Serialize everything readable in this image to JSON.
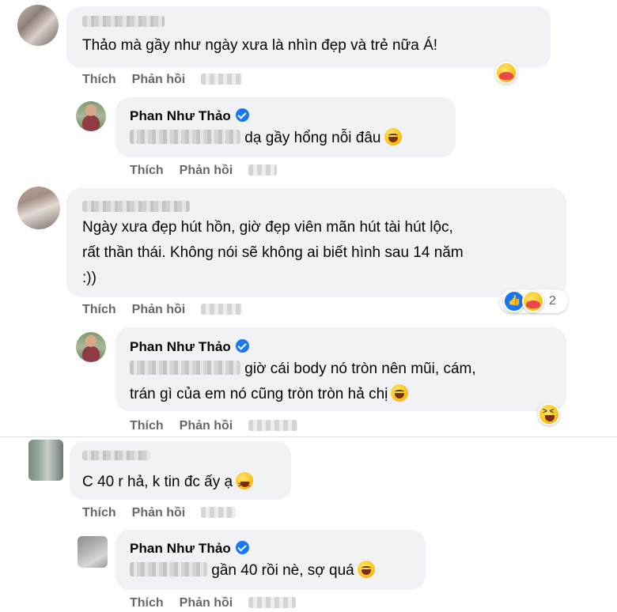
{
  "comments": [
    {
      "text": "Thảo mà gầy như ngày xưa là nhìn đẹp và trẻ nữa Á!",
      "actions": {
        "like": "Thích",
        "reply": "Phản hồi"
      },
      "reply": {
        "author": "Phan Như Thảo",
        "text": "dạ gầy hổng nỗi đâu",
        "actions": {
          "like": "Thích",
          "reply": "Phản hồi"
        }
      }
    },
    {
      "lines": [
        "Ngày xưa đẹp hút hồn, giờ đẹp viên mãn hút tài hút lộc,",
        "rất thần thái. Không nói sẽ không ai biết hình sau 14 năm",
        ":))"
      ],
      "reaction_count": "2",
      "actions": {
        "like": "Thích",
        "reply": "Phản hồi"
      },
      "reply": {
        "author": "Phan Như Thảo",
        "line1": "giờ cái body nó tròn nên mũi, cám,",
        "line2": "trán gì của em nó cũng tròn tròn hả chị",
        "actions": {
          "like": "Thích",
          "reply": "Phản hồi"
        }
      }
    },
    {
      "text": "C 40 r hả, k tin đc ấy ạ",
      "actions": {
        "like": "Thích",
        "reply": "Phản hồi"
      },
      "reply": {
        "author": "Phan Như Thảo",
        "text": "gần 40 rồi nè, sợ quá",
        "actions": {
          "like": "Thích",
          "reply": "Phản hồi"
        }
      }
    }
  ],
  "icons": [
    "laughing-emoji-icon",
    "squinting-laugh-emoji-icon",
    "care-reaction-icon",
    "like-reaction-icon",
    "haha-reaction-icon",
    "verified-badge-icon"
  ],
  "colors": {
    "bubble": "#f0f2f5",
    "action_text": "#65676b",
    "verified": "#1877f2"
  }
}
